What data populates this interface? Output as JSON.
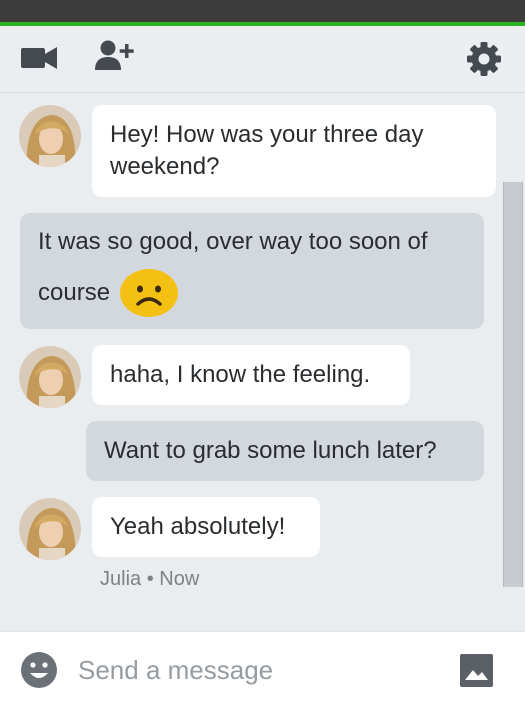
{
  "toolbar": {
    "video_icon": "video-camera-icon",
    "add_person_icon": "add-person-icon",
    "settings_icon": "gear-icon"
  },
  "messages": [
    {
      "direction": "in",
      "text_line1": "Hey! How was your three day",
      "text_line2": "weekend?"
    },
    {
      "direction": "out",
      "text_line1": "It was so good, over way too soon of",
      "text_line2": "course",
      "emoji": "frowning-face-emoji"
    },
    {
      "direction": "in",
      "text": "haha, I know the feeling."
    },
    {
      "direction": "out",
      "text": "Want to grab some lunch later?"
    },
    {
      "direction": "in",
      "text": "Yeah absolutely!"
    }
  ],
  "last_meta": {
    "sender": "Julia",
    "separator": "•",
    "time": "Now"
  },
  "composer": {
    "emoji_icon": "smiley-icon",
    "placeholder": "Send a message",
    "value": "",
    "image_icon": "image-icon"
  },
  "colors": {
    "accent": "#2bb31f",
    "topbar": "#3c3c3c",
    "incoming_bubble": "#ffffff",
    "outgoing_bubble": "#d2d8dd",
    "background": "#e9edf0"
  }
}
